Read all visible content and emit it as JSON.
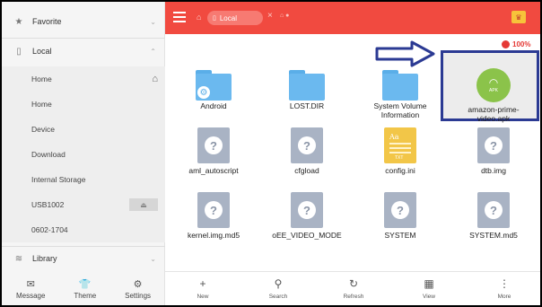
{
  "sidebar": {
    "favorite": "Favorite",
    "local": "Local",
    "library": "Library",
    "items": [
      {
        "label": "Home"
      },
      {
        "label": "Home"
      },
      {
        "label": "Device"
      },
      {
        "label": "Download"
      },
      {
        "label": "Internal Storage"
      },
      {
        "label": "USB1002"
      },
      {
        "label": "0602-1704"
      }
    ],
    "bottom": [
      {
        "label": "Message",
        "icon": "message-icon"
      },
      {
        "label": "Theme",
        "icon": "theme-icon"
      },
      {
        "label": "Settings",
        "icon": "settings-icon"
      }
    ]
  },
  "topbar": {
    "tab_label": "Local",
    "storage_percent": "100%",
    "accent": "#f14a40"
  },
  "files": [
    {
      "name": "Android",
      "type": "folder-settings"
    },
    {
      "name": "LOST.DIR",
      "type": "folder"
    },
    {
      "name": "System Volume Information",
      "type": "folder"
    },
    {
      "name": "amazon-prime-video.apk",
      "type": "apk",
      "apk_badge": "APK"
    },
    {
      "name": "aml_autoscript",
      "type": "unknown"
    },
    {
      "name": "cfgload",
      "type": "unknown"
    },
    {
      "name": "config.ini",
      "type": "ini",
      "ini_glyph": "Aa",
      "ini_ext": "TXT"
    },
    {
      "name": "dtb.img",
      "type": "unknown"
    },
    {
      "name": "kernel.img.md5",
      "type": "unknown"
    },
    {
      "name": "oEE_VIDEO_MODE",
      "type": "unknown"
    },
    {
      "name": "SYSTEM",
      "type": "unknown"
    },
    {
      "name": "SYSTEM.md5",
      "type": "unknown"
    }
  ],
  "toolbar": [
    {
      "label": "New",
      "icon": "plus-icon"
    },
    {
      "label": "Search",
      "icon": "search-icon"
    },
    {
      "label": "Refresh",
      "icon": "refresh-icon"
    },
    {
      "label": "View",
      "icon": "view-grid-icon"
    },
    {
      "label": "More",
      "icon": "more-vertical-icon"
    }
  ]
}
